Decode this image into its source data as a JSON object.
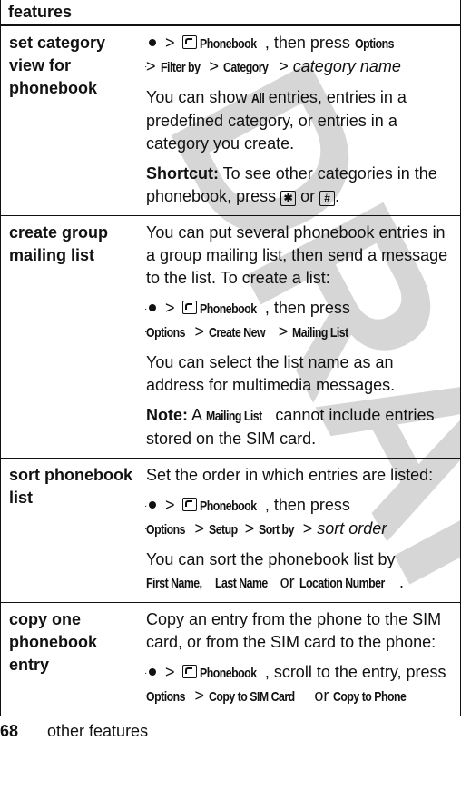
{
  "table": {
    "header": "features",
    "rows": [
      {
        "feature": "set category view for phonebook",
        "path1": {
          "sep": ">",
          "menu": "Phonebook",
          "then": ", then press ",
          "options": "Options",
          "filter": "Filter by",
          "category": "Category",
          "arg": "category name"
        },
        "text1_a": "You can show ",
        "text1_b": "All",
        "text1_c": " entries, entries in a predefined category, or entries in a category you create.",
        "shortcut_label": "Shortcut:",
        "shortcut_text": " To see other categories in the phonebook, press ",
        "key_star": "✱",
        "or": " or ",
        "key_hash": "#",
        "period": "."
      },
      {
        "feature": "create group mailing list",
        "intro": "You can put several phonebook entries in a group mailing list, then send a message to the list. To create a list:",
        "path": {
          "menu": "Phonebook",
          "then": ", then press",
          "options": "Options",
          "create_new": "Create New",
          "mailing_list": "Mailing List"
        },
        "text2": "You can select the list name as an address for multimedia messages.",
        "note_label": "Note:",
        "note_a": " A ",
        "note_key": "Mailing List",
        "note_b": " cannot include entries stored on the SIM card."
      },
      {
        "feature": "sort phonebook list",
        "intro": "Set the order in which entries are listed:",
        "path": {
          "menu": "Phonebook",
          "then": ", then press",
          "options": "Options",
          "setup": "Setup",
          "sort_by": "Sort by",
          "arg": "sort order"
        },
        "text_a": "You can sort the phonebook list by ",
        "first_name": "First Name,",
        "last_name": "Last Name",
        "or": " or ",
        "location": "Location Number",
        "period": "."
      },
      {
        "feature": "copy one phonebook entry",
        "intro": "Copy an entry from the phone to the SIM card, or from the SIM card to the phone:",
        "path": {
          "menu": "Phonebook",
          "scroll": ", scroll to the entry, press ",
          "options": "Options",
          "copy_sim": "Copy to SIM Card",
          "or": " or ",
          "copy_phone": "Copy to Phone"
        }
      }
    ]
  },
  "footer": {
    "page_number": "68",
    "section": "other features"
  },
  "watermark": "DRAFT",
  "icons": {
    "nav": "nav-key-icon",
    "phonebook": "phonebook-icon",
    "star": "star-key-icon",
    "hash": "hash-key-icon"
  },
  "sep": ">"
}
